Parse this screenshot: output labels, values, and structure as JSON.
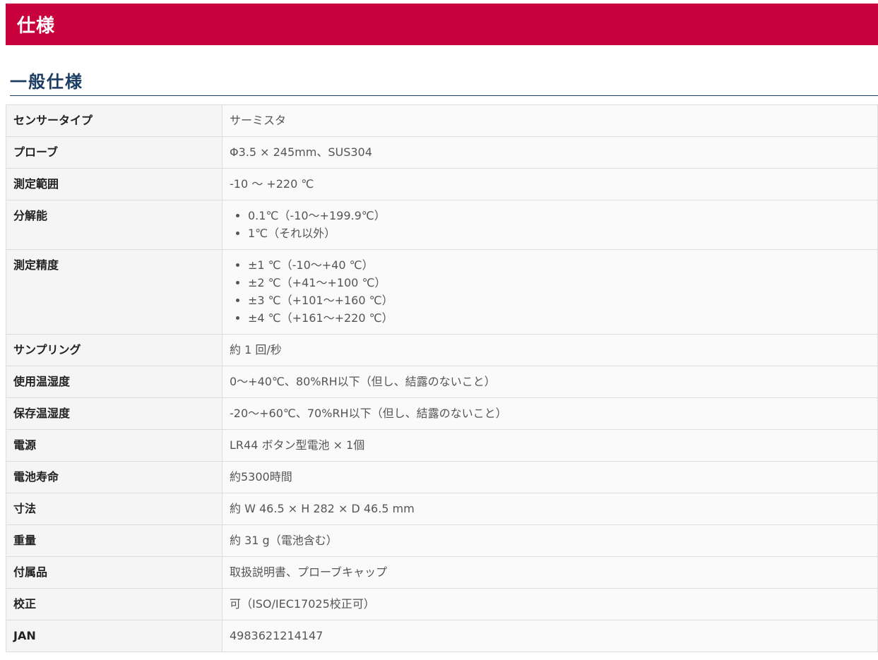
{
  "banner": {
    "title": "仕様"
  },
  "section": {
    "title": "一般仕様"
  },
  "specs": {
    "rows": [
      {
        "key": "センサータイプ",
        "value": "サーミスタ"
      },
      {
        "key": "プローブ",
        "value": "Φ3.5 × 245mm、SUS304"
      },
      {
        "key": "測定範囲",
        "value": "-10 ～ +220 ℃"
      },
      {
        "key": "分解能",
        "items": [
          "0.1℃（-10～+199.9℃）",
          "1℃（それ以外）"
        ]
      },
      {
        "key": "測定精度",
        "items": [
          "±1 ℃（-10～+40 ℃）",
          "±2 ℃（+41～+100 ℃）",
          "±3 ℃（+101～+160 ℃）",
          "±4 ℃（+161～+220 ℃）"
        ]
      },
      {
        "key": "サンプリング",
        "value": "約 1 回/秒"
      },
      {
        "key": "使用温湿度",
        "value": "0～+40℃、80%RH以下（但し、結露のないこと）"
      },
      {
        "key": "保存温湿度",
        "value": "-20～+60℃、70%RH以下（但し、結露のないこと）"
      },
      {
        "key": "電源",
        "value": "LR44 ボタン型電池 × 1個"
      },
      {
        "key": "電池寿命",
        "value": "約5300時間"
      },
      {
        "key": "寸法",
        "value": "約 W 46.5 × H 282 × D 46.5 mm"
      },
      {
        "key": "重量",
        "value": "約 31 g（電池含む）"
      },
      {
        "key": "付属品",
        "value": "取扱説明書、プローブキャップ"
      },
      {
        "key": "校正",
        "value": "可（ISO/IEC17025校正可）"
      },
      {
        "key": "JAN",
        "value": "4983621214147"
      }
    ]
  }
}
